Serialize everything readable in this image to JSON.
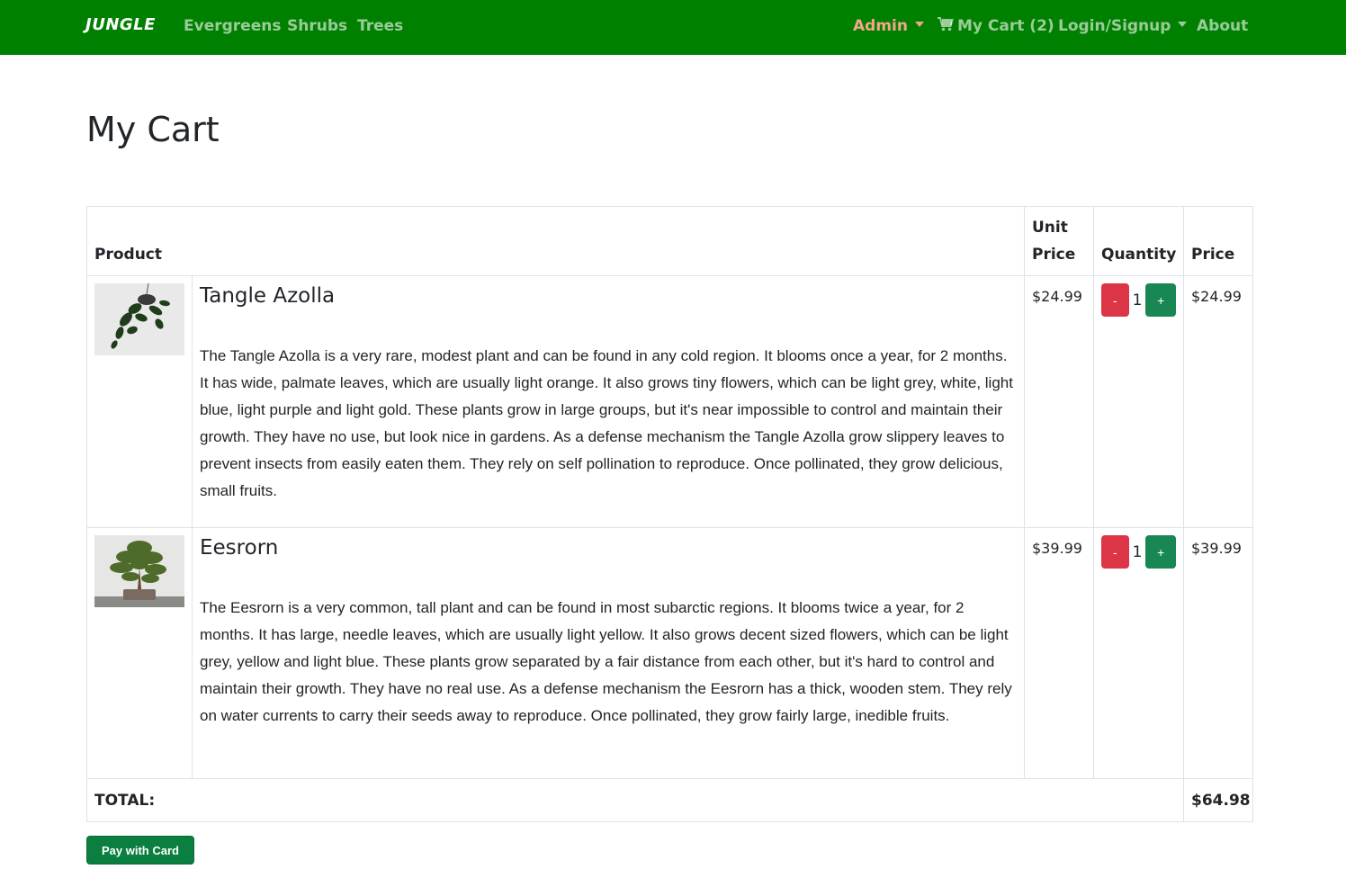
{
  "navbar": {
    "brand": "JUNGLE",
    "links": [
      "Evergreens",
      "Shrubs",
      "Trees"
    ],
    "admin": "Admin",
    "cart": "My Cart (2)",
    "login": "Login/Signup",
    "about": "About"
  },
  "page": {
    "title": "My Cart"
  },
  "table": {
    "headers": {
      "product": "Product",
      "unit_price": "Unit Price",
      "quantity": "Quantity",
      "price": "Price"
    },
    "items": [
      {
        "name": "Tangle Azolla",
        "description": "The Tangle Azolla is a very rare, modest plant and can be found in any cold region. It blooms once a year, for 2 months. It has wide, palmate leaves, which are usually light orange. It also grows tiny flowers, which can be light grey, white, light blue, light purple and light gold. These plants grow in large groups, but it's near impossible to control and maintain their growth. They have no use, but look nice in gardens. As a defense mechanism the Tangle Azolla grow slippery leaves to prevent insects from easily eaten them. They rely on self pollination to reproduce. Once pollinated, they grow delicious, small fruits.",
        "unit_price": "$24.99",
        "quantity": "1",
        "price": "$24.99"
      },
      {
        "name": "Eesrorn",
        "description": "The Eesrorn is a very common, tall plant and can be found in most subarctic regions. It blooms twice a year, for 2 months. It has large, needle leaves, which are usually light yellow. It also grows decent sized flowers, which can be light grey, yellow and light blue. These plants grow separated by a fair distance from each other, but it's hard to control and maintain their growth. They have no real use. As a defense mechanism the Eesrorn has a thick, wooden stem. They rely on water currents to carry their seeds away to reproduce. Once pollinated, they grow fairly large, inedible fruits.",
        "unit_price": "$39.99",
        "quantity": "1",
        "price": "$39.99"
      }
    ],
    "decrement_label": "-",
    "increment_label": "+",
    "total_label": "TOTAL:",
    "total_value": "$64.98"
  },
  "pay_button": "Pay with Card",
  "colors": {
    "navbar": "#008000",
    "admin": "#f5a58a",
    "minus": "#dc3545",
    "plus": "#198754",
    "pay": "#0a7f3f"
  }
}
